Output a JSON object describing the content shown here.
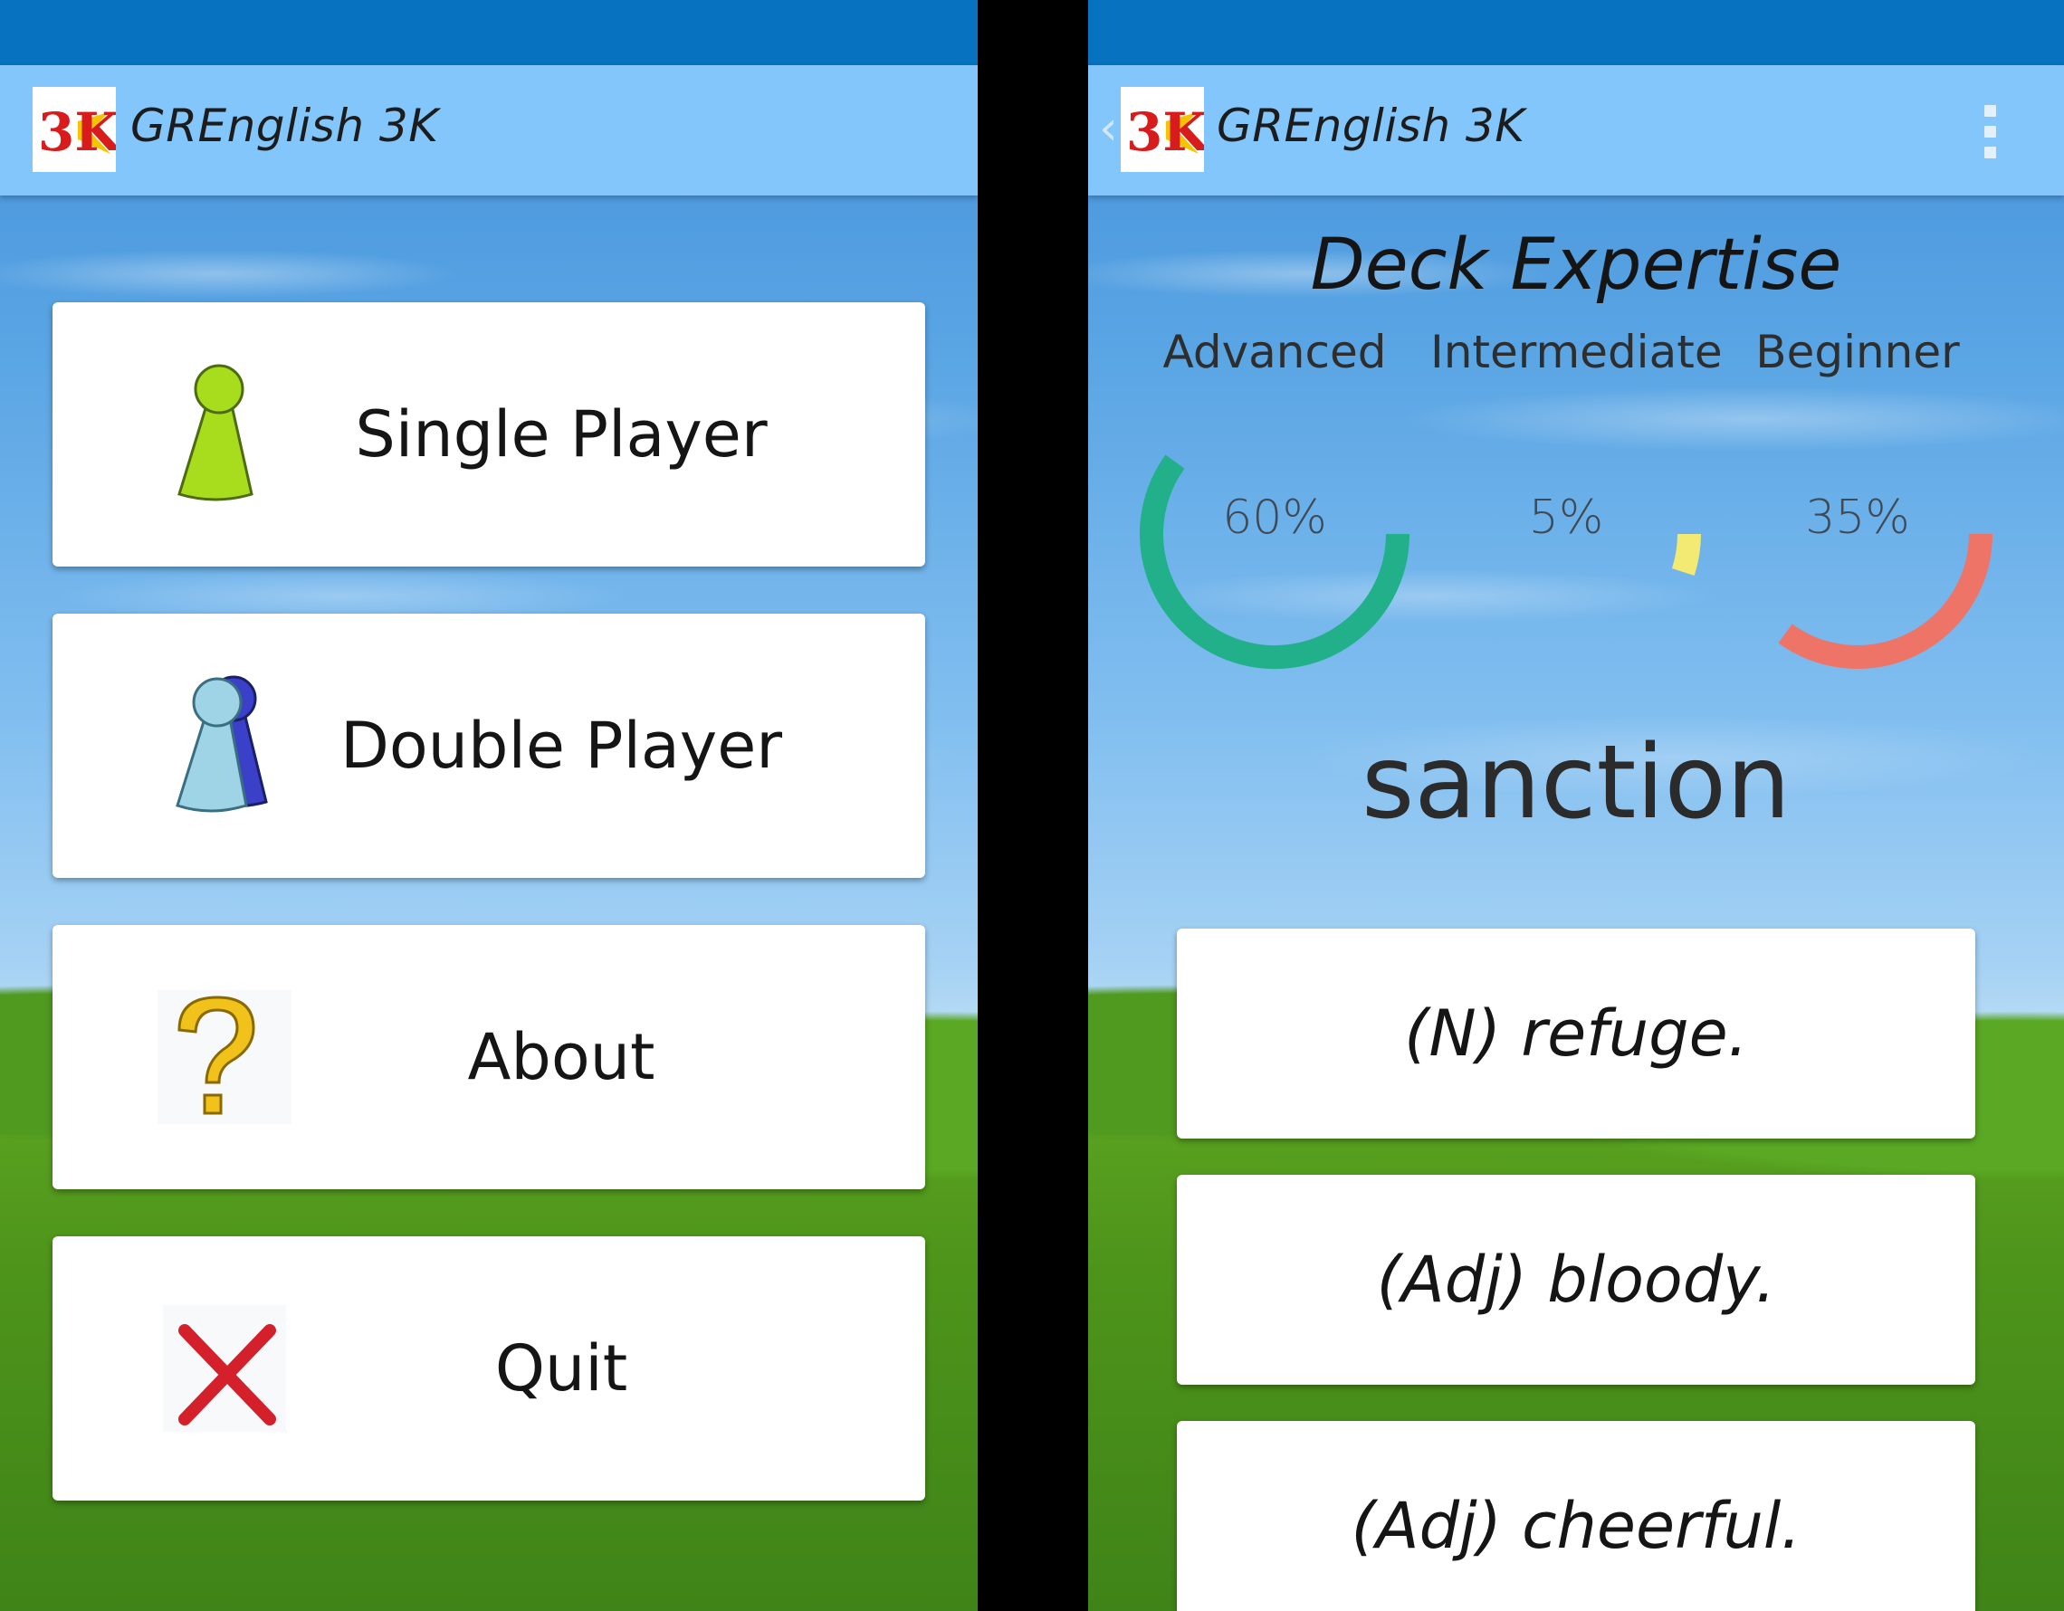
{
  "app": {
    "title": "GREnglish 3K",
    "logo_text": "3K",
    "colors": {
      "status_bar": "#0672c0",
      "app_bar": "#82c6fb"
    }
  },
  "main_menu": {
    "items": [
      {
        "label": "Single Player",
        "icon": "single-player-pawn-icon"
      },
      {
        "label": "Double Player",
        "icon": "double-player-pawns-icon"
      },
      {
        "label": "About",
        "icon": "question-mark-icon"
      },
      {
        "label": "Quit",
        "icon": "red-x-icon"
      }
    ]
  },
  "quiz": {
    "title": "Deck Expertise",
    "levels": [
      {
        "label": "Advanced",
        "percent_text": "60%",
        "value": 60,
        "color": "#21b089"
      },
      {
        "label": "Intermediate",
        "percent_text": "5%",
        "value": 5,
        "color": "#f2ea72"
      },
      {
        "label": "Beginner",
        "percent_text": "35%",
        "value": 35,
        "color": "#ee7468"
      }
    ],
    "word": "sanction",
    "answers": [
      {
        "text": "(N) refuge."
      },
      {
        "text": "(Adj) bloody."
      },
      {
        "text": "(Adj) cheerful."
      }
    ]
  }
}
